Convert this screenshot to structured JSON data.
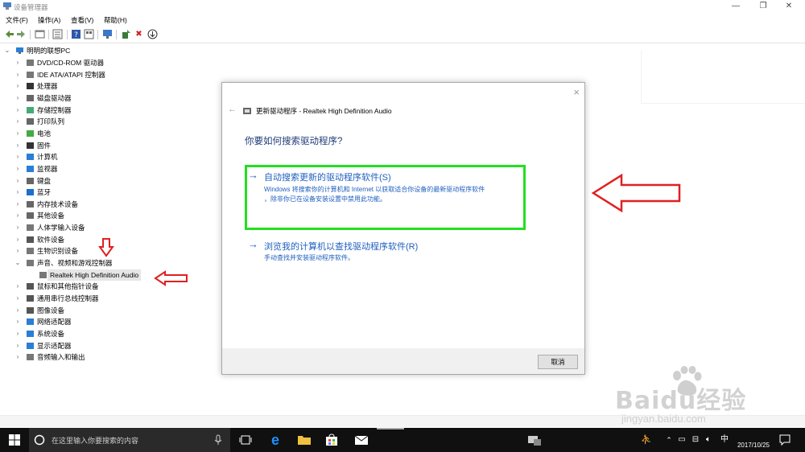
{
  "window": {
    "title": "设备管理器",
    "minimize": "—",
    "maximize": "❐",
    "close": "✕"
  },
  "menu": [
    "文件(F)",
    "操作(A)",
    "查看(V)",
    "帮助(H)"
  ],
  "toolbar": {
    "icons": [
      "back-arrow-icon",
      "forward-arrow-icon",
      "properties-icon",
      "list-icon",
      "help-icon",
      "monitor-icon",
      "update-driver-icon",
      "uninstall-icon",
      "scan-icon"
    ]
  },
  "tree": {
    "root": "明明的联想PC",
    "items": [
      {
        "label": "DVD/CD-ROM 驱动器",
        "icon": "dvd-drive-icon",
        "color": "#777"
      },
      {
        "label": "IDE ATA/ATAPI 控制器",
        "icon": "ide-controller-icon",
        "color": "#777"
      },
      {
        "label": "处理器",
        "icon": "cpu-icon",
        "color": "#333"
      },
      {
        "label": "磁盘驱动器",
        "icon": "disk-drive-icon",
        "color": "#666"
      },
      {
        "label": "存储控制器",
        "icon": "storage-controller-icon",
        "color": "#4a7"
      },
      {
        "label": "打印队列",
        "icon": "printer-icon",
        "color": "#666"
      },
      {
        "label": "电池",
        "icon": "battery-icon",
        "color": "#4a4"
      },
      {
        "label": "固件",
        "icon": "firmware-icon",
        "color": "#333"
      },
      {
        "label": "计算机",
        "icon": "computer-icon",
        "color": "#2a7fd4"
      },
      {
        "label": "监视器",
        "icon": "monitor-icon",
        "color": "#2a7fd4"
      },
      {
        "label": "键盘",
        "icon": "keyboard-icon",
        "color": "#666"
      },
      {
        "label": "蓝牙",
        "icon": "bluetooth-icon",
        "color": "#1a6fd0"
      },
      {
        "label": "内存技术设备",
        "icon": "memory-icon",
        "color": "#666"
      },
      {
        "label": "其他设备",
        "icon": "other-device-icon",
        "color": "#666"
      },
      {
        "label": "人体学输入设备",
        "icon": "hid-icon",
        "color": "#777"
      },
      {
        "label": "软件设备",
        "icon": "software-device-icon",
        "color": "#555"
      },
      {
        "label": "生物识别设备",
        "icon": "biometric-icon",
        "color": "#777"
      },
      {
        "label": "声音、视频和游戏控制器",
        "icon": "speaker-icon",
        "color": "#777",
        "expanded": true
      },
      {
        "label": "Realtek High Definition Audio",
        "icon": "speaker-icon",
        "color": "#777",
        "child": true,
        "selected": true
      },
      {
        "label": "鼠标和其他指针设备",
        "icon": "mouse-icon",
        "color": "#555"
      },
      {
        "label": "通用串行总线控制器",
        "icon": "usb-icon",
        "color": "#555"
      },
      {
        "label": "图像设备",
        "icon": "camera-icon",
        "color": "#555"
      },
      {
        "label": "网络适配器",
        "icon": "network-icon",
        "color": "#2a7fd4"
      },
      {
        "label": "系统设备",
        "icon": "system-device-icon",
        "color": "#2a7fd4"
      },
      {
        "label": "显示适配器",
        "icon": "display-adapter-icon",
        "color": "#2a7fd4"
      },
      {
        "label": "音频输入和输出",
        "icon": "audio-io-icon",
        "color": "#777"
      }
    ]
  },
  "dialog": {
    "header": "更新驱动程序 - Realtek High Definition Audio",
    "question": "你要如何搜索驱动程序?",
    "option1": {
      "title": "自动搜索更新的驱动程序软件(S)",
      "desc1": "Windows 将搜索你的计算机和 Internet 以获取适合你设备的最新驱动程序软件",
      "desc2": "，除非你已在设备安装设置中禁用此功能。"
    },
    "option2": {
      "title": "浏览我的计算机以查找驱动程序软件(R)",
      "desc": "手动查找并安装驱动程序软件。"
    },
    "cancel": "取消",
    "close": "×",
    "back": "←"
  },
  "taskbar": {
    "search_placeholder": "在这里输入你要搜索的内容",
    "time": "2017/10/25",
    "ime": "中",
    "apps": [
      "task-view-icon",
      "edge-icon",
      "file-explorer-icon",
      "store-icon",
      "mail-icon",
      "device-manager-icon"
    ]
  },
  "watermark": {
    "logo": "Baidu经验",
    "url": "jingyan.baidu.com"
  },
  "colors": {
    "link": "#1f5fbf",
    "highlight": "#22e022",
    "annotation": "#e02020"
  }
}
